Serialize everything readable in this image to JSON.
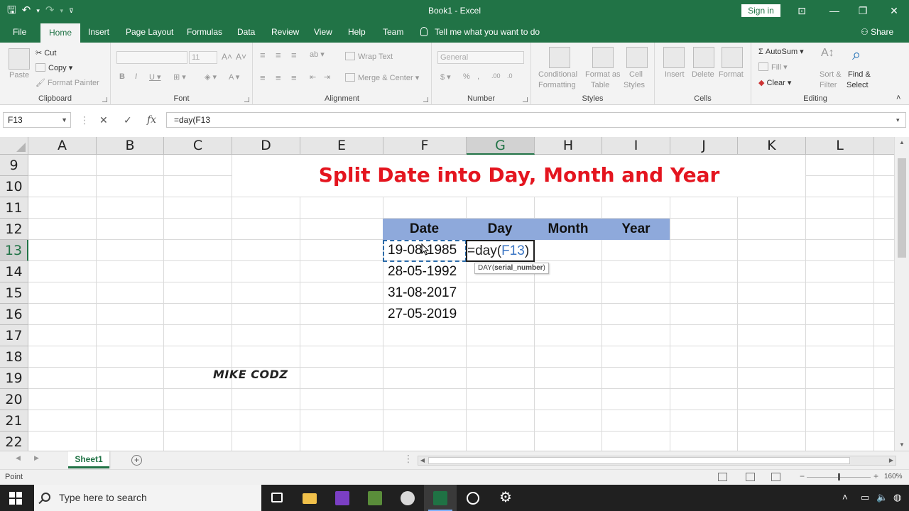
{
  "window": {
    "title": "Book1  -  Excel",
    "signin": "Sign in",
    "share": "Share"
  },
  "ribbon": {
    "tabs": [
      "File",
      "Home",
      "Insert",
      "Page Layout",
      "Formulas",
      "Data",
      "Review",
      "View",
      "Help",
      "Team"
    ],
    "active_tab": "Home",
    "tell_me": "Tell me what you want to do",
    "clipboard": {
      "paste": "Paste",
      "cut": "Cut",
      "copy": "Copy",
      "format_painter": "Format Painter",
      "label": "Clipboard"
    },
    "font": {
      "name": "",
      "size": "11",
      "label": "Font"
    },
    "alignment": {
      "wrap_text": "Wrap Text",
      "merge_center": "Merge & Center",
      "label": "Alignment"
    },
    "number": {
      "format": "General",
      "label": "Number"
    },
    "styles": {
      "conditional": "Conditional",
      "formatting": "Formatting",
      "format_as": "Format as",
      "table": "Table",
      "cell": "Cell",
      "cell_styles": "Styles",
      "label": "Styles"
    },
    "cells": {
      "insert": "Insert",
      "delete": "Delete",
      "format": "Format",
      "label": "Cells"
    },
    "editing": {
      "autosum": "AutoSum",
      "fill": "Fill",
      "clear": "Clear",
      "sort": "Sort &",
      "filter": "Filter",
      "find": "Find &",
      "select": "Select",
      "label": "Editing"
    }
  },
  "formula_bar": {
    "name_box": "F13",
    "cancel": "✕",
    "enter": "✓",
    "fx": "fx",
    "formula": "=day(F13"
  },
  "grid": {
    "columns": [
      "A",
      "B",
      "C",
      "D",
      "E",
      "F",
      "G",
      "H",
      "I",
      "J",
      "K",
      "L"
    ],
    "selected_column": "G",
    "rows": [
      "9",
      "10",
      "11",
      "12",
      "13",
      "14",
      "15",
      "16",
      "17",
      "18",
      "19",
      "20",
      "21",
      "22"
    ],
    "selected_row": "13",
    "title": "Split Date into Day, Month and Year",
    "table_headers": [
      "Date",
      "Day",
      "Month",
      "Year"
    ],
    "dates": [
      "19-08-1985",
      "28-05-1992",
      "31-08-2017",
      "27-05-2019"
    ],
    "edit_prefix": "=day(",
    "edit_ref": "F13",
    "edit_suffix": ")",
    "tooltip_fn": "DAY(",
    "tooltip_arg": "serial_number",
    "tooltip_close": ")",
    "watermark": "MIKE CODZ"
  },
  "sheets": {
    "tabs": [
      "Sheet1"
    ],
    "add": "+"
  },
  "status": {
    "mode": "Point",
    "zoom": "160%"
  },
  "taskbar": {
    "search_placeholder": "Type here to search"
  },
  "colors": {
    "excel_green": "#217346",
    "title_red": "#e4151f",
    "header_band": "#8ea9db",
    "reference_blue": "#3b76c4"
  }
}
